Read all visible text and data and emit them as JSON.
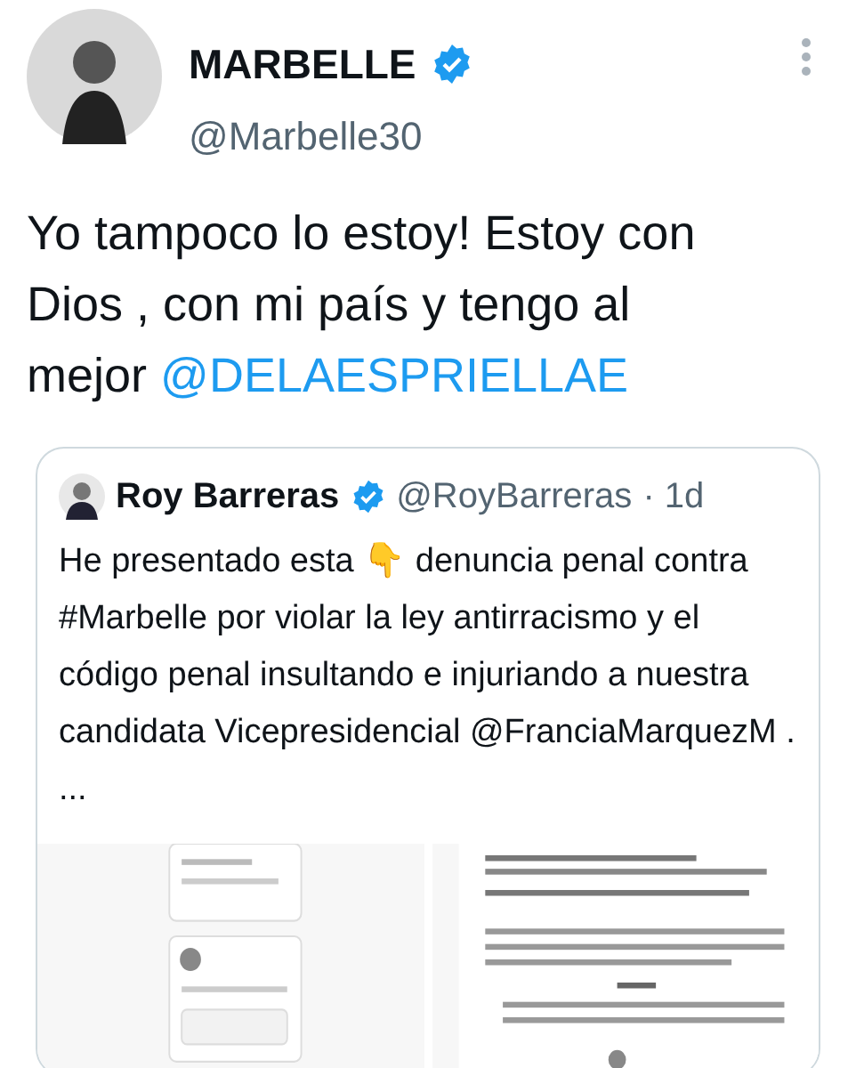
{
  "tweet": {
    "author": {
      "name": "MARBELLE",
      "handle": "@Marbelle30",
      "verified": true
    },
    "text": "Yo tampoco lo estoy! Estoy con Dios , con mi país y tengo al mejor",
    "mention": "@DELAESPRIELLAE",
    "quoted": {
      "author": {
        "name": "Roy Barreras",
        "handle": "@RoyBarreras",
        "verified": true
      },
      "time": "· 1d",
      "text": "He presentado esta 👇 denuncia penal contra #Marbelle por violar la ley antirracismo y el código penal insultando e injuriando a nuestra candidata Vicepresidencial @FranciaMarquezM . ..."
    }
  }
}
